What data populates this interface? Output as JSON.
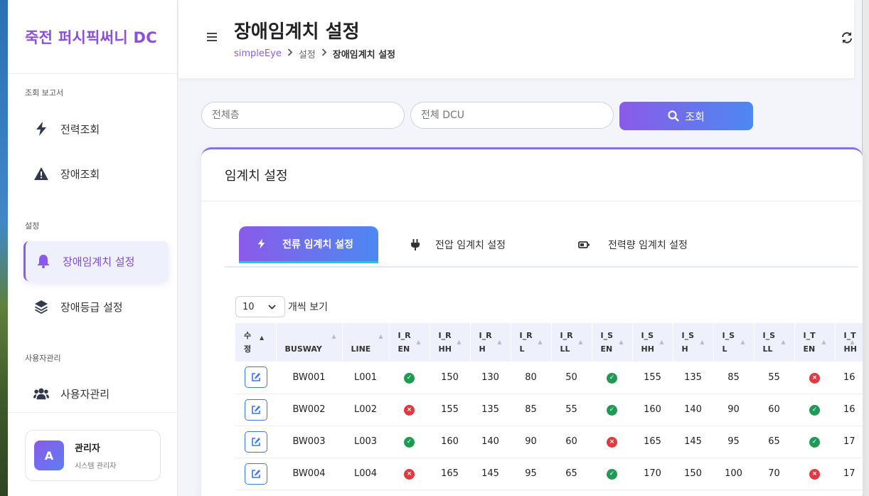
{
  "sidebar": {
    "brand": "죽전 퍼시픽써니 DC",
    "sections": [
      {
        "label": "조회 보고서"
      },
      {
        "label": "설정"
      },
      {
        "label": "사용자관리"
      }
    ],
    "items": [
      {
        "label": "전력조회",
        "icon": "bolt-icon"
      },
      {
        "label": "장애조회",
        "icon": "warning-icon"
      },
      {
        "label": "장애임계치 설정",
        "icon": "bell-icon",
        "active": true
      },
      {
        "label": "장애등급 설정",
        "icon": "layers-icon"
      },
      {
        "label": "사용자관리",
        "icon": "users-icon"
      }
    ],
    "user": {
      "initial": "A",
      "name": "관리자",
      "role": "시스템 관리자"
    }
  },
  "header": {
    "title": "장애임계치 설정",
    "breadcrumb": [
      "simpleEye",
      "설정",
      "장애임계치 설정"
    ]
  },
  "filters": {
    "floor_placeholder": "전체층",
    "dcu_placeholder": "전체 DCU",
    "search_label": "조회"
  },
  "card": {
    "title": "임계치 설정",
    "tabs": [
      {
        "label": "전류 임계치 설정",
        "icon": "bolt-icon",
        "active": true
      },
      {
        "label": "전압 임계치 설정",
        "icon": "plug-icon"
      },
      {
        "label": "전력량 임계치 설정",
        "icon": "battery-icon"
      }
    ],
    "page_size": "10",
    "page_size_label": "개씩 보기"
  },
  "table": {
    "columns": [
      {
        "line1": "수",
        "line2": "정"
      },
      {
        "line1": "",
        "line2": "BUSWAY"
      },
      {
        "line1": "",
        "line2": "LINE"
      },
      {
        "line1": "I_R",
        "line2": "EN"
      },
      {
        "line1": "I_R",
        "line2": "HH"
      },
      {
        "line1": "I_R",
        "line2": "H"
      },
      {
        "line1": "I_R",
        "line2": "L"
      },
      {
        "line1": "I_R",
        "line2": "LL"
      },
      {
        "line1": "I_S",
        "line2": "EN"
      },
      {
        "line1": "I_S",
        "line2": "HH"
      },
      {
        "line1": "I_S",
        "line2": "H"
      },
      {
        "line1": "I_S",
        "line2": "L"
      },
      {
        "line1": "I_S",
        "line2": "LL"
      },
      {
        "line1": "I_T",
        "line2": "EN"
      },
      {
        "line1": "I_T",
        "line2": "HH"
      }
    ],
    "rows": [
      {
        "busway": "BW001",
        "line": "L001",
        "ir_en": true,
        "ir_hh": "150",
        "ir_h": "130",
        "ir_l": "80",
        "ir_ll": "50",
        "is_en": true,
        "is_hh": "155",
        "is_h": "135",
        "is_l": "85",
        "is_ll": "55",
        "it_en": false,
        "it_hh": "16"
      },
      {
        "busway": "BW002",
        "line": "L002",
        "ir_en": false,
        "ir_hh": "155",
        "ir_h": "135",
        "ir_l": "85",
        "ir_ll": "55",
        "is_en": true,
        "is_hh": "160",
        "is_h": "140",
        "is_l": "90",
        "is_ll": "60",
        "it_en": true,
        "it_hh": "16"
      },
      {
        "busway": "BW003",
        "line": "L003",
        "ir_en": true,
        "ir_hh": "160",
        "ir_h": "140",
        "ir_l": "90",
        "ir_ll": "60",
        "is_en": false,
        "is_hh": "165",
        "is_h": "145",
        "is_l": "95",
        "is_ll": "65",
        "it_en": true,
        "it_hh": "17"
      },
      {
        "busway": "BW004",
        "line": "L004",
        "ir_en": false,
        "ir_hh": "165",
        "ir_h": "145",
        "ir_l": "95",
        "ir_ll": "65",
        "is_en": true,
        "is_hh": "170",
        "is_h": "150",
        "is_l": "100",
        "is_ll": "70",
        "it_en": false,
        "it_hh": "17"
      }
    ]
  },
  "colors": {
    "accent": "#8a5be8",
    "accent2": "#4d88f2",
    "ok": "#1f9a55",
    "error": "#e2383f"
  }
}
